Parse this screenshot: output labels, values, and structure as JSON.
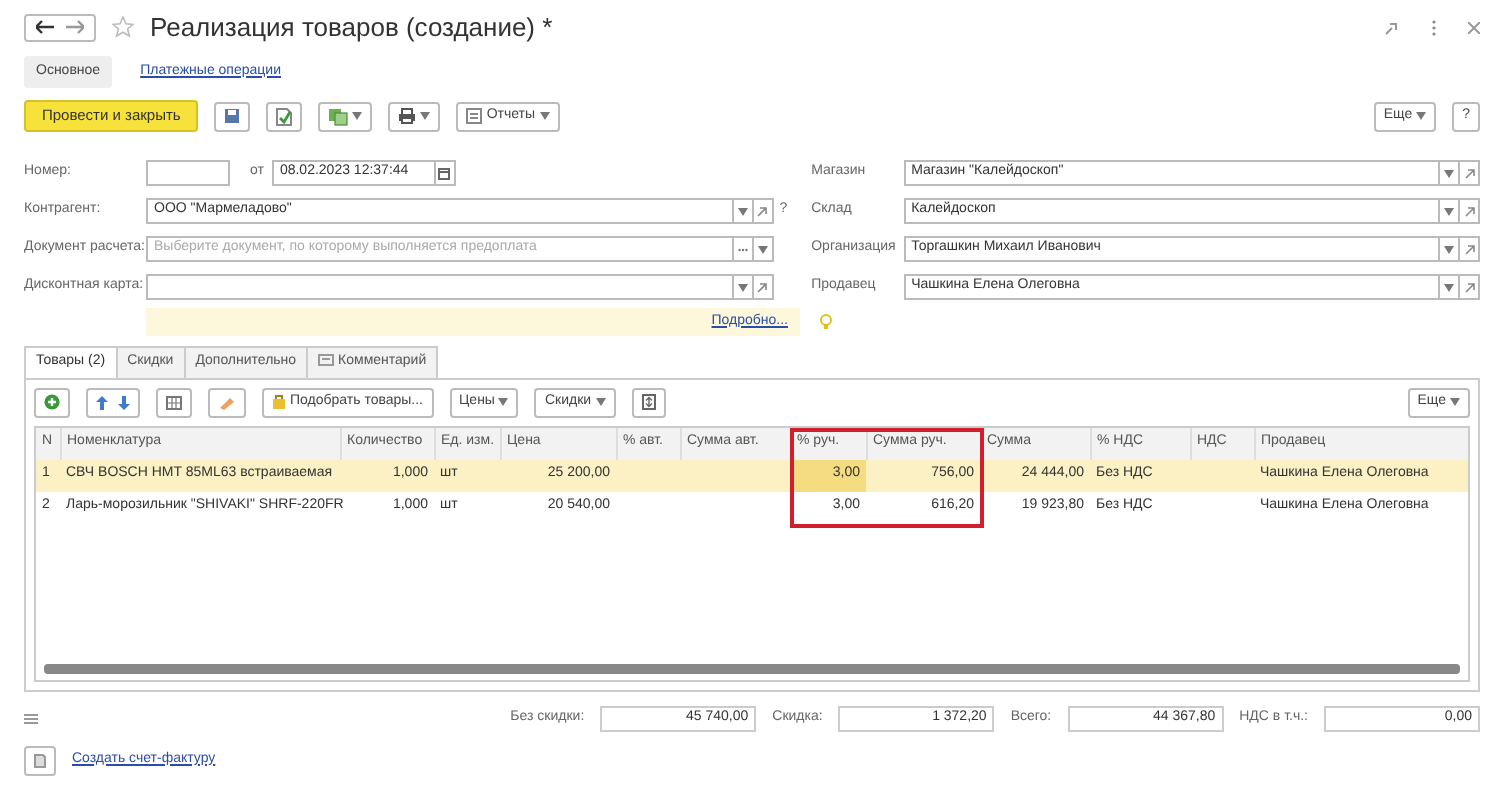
{
  "window": {
    "title": "Реализация товаров (создание) *"
  },
  "form_tabs": [
    {
      "label": "Основное",
      "selected": true
    },
    {
      "label": "Платежные операции",
      "selected": false
    }
  ],
  "toolbar": {
    "post_button": "Провести и закрыть",
    "reports_button": "Отчеты",
    "more_button": "Еще",
    "help_button": "?"
  },
  "fields_left": [
    {
      "kind": "number",
      "label": "Номер:",
      "date_label": "от",
      "date": "08.02.2023 12:37:44"
    },
    {
      "kind": "select",
      "label": "Контрагент:",
      "value": "ООО \"Мармеладово\"",
      "suffix": "?"
    },
    {
      "kind": "choice",
      "label": "Документ расчета:",
      "placeholder": "Выберите документ, по которому выполняется предоплата"
    },
    {
      "kind": "select",
      "label": "Дисконтная карта:"
    }
  ],
  "fields_right": [
    {
      "label": "Магазин",
      "value": "Магазин \"Калейдоскоп\""
    },
    {
      "label": "Склад",
      "value": "Калейдоскоп"
    },
    {
      "label": "Организация",
      "value": "Торгашкин Михаил Иванович"
    },
    {
      "label": "Продавец",
      "value": "Чашкина Елена Олеговна"
    }
  ],
  "details_link": "Подробно...",
  "tabs": [
    {
      "label": "Товары (2)",
      "selected": true
    },
    {
      "label": "Скидки",
      "selected": false
    },
    {
      "label": "Дополнительно",
      "selected": false
    },
    {
      "label": "Комментарий",
      "selected": false
    }
  ],
  "table_toolbar": {
    "pick_button": "Подобрать товары...",
    "prices_button": "Цены",
    "discounts_button": "Скидки",
    "more_button": "Еще"
  },
  "table": {
    "columns": [
      {
        "label": "N",
        "highlighted": false
      },
      {
        "label": "Номенклатура",
        "highlighted": false
      },
      {
        "label": "Количество",
        "highlighted": false
      },
      {
        "label": "Ед. изм.",
        "highlighted": false
      },
      {
        "label": "Цена",
        "highlighted": false
      },
      {
        "label": "% авт.",
        "highlighted": false
      },
      {
        "label": "Сумма авт.",
        "highlighted": false
      },
      {
        "label": "% руч.",
        "highlighted": true
      },
      {
        "label": "Сумма руч.",
        "highlighted": true
      },
      {
        "label": "Сумма",
        "highlighted": false
      },
      {
        "label": "% НДС",
        "highlighted": false
      },
      {
        "label": "НДС",
        "highlighted": false
      },
      {
        "label": "Продавец",
        "highlighted": false
      }
    ],
    "rows": [
      {
        "selected": true,
        "cells": [
          "1",
          "СВЧ BOSCH HMT 85ML63 встраиваемая",
          "1,000",
          "шт",
          "25 200,00",
          "",
          "",
          "3,00",
          "756,00",
          "24 444,00",
          "Без НДС",
          "",
          "Чашкина Елена Олеговна"
        ]
      },
      {
        "selected": false,
        "cells": [
          "2",
          "Ларь-морозильник \"SHIVAKI\" SHRF-220FR",
          "1,000",
          "шт",
          "20 540,00",
          "",
          "",
          "3,00",
          "616,20",
          "19 923,80",
          "Без НДС",
          "",
          "Чашкина Елена Олеговна"
        ]
      }
    ]
  },
  "totals": [
    {
      "label": "Без скидки:",
      "value": "45 740,00"
    },
    {
      "label": "Скидка:",
      "value": "1 372,20"
    },
    {
      "label": "Всего:",
      "value": "44 367,80"
    },
    {
      "label": "НДС в т.ч.:",
      "value": "0,00"
    }
  ],
  "invoice_link": "Создать счет-фактуру"
}
